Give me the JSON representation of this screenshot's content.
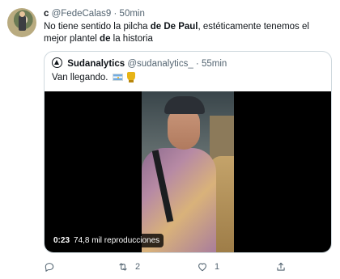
{
  "tweet": {
    "author_name": "c",
    "author_handle": "@FedeCalas9",
    "separator": "·",
    "time": "50min",
    "text_part1": "No tiene sentido la pilcha ",
    "text_bold1": "de De Paul",
    "text_part2": ", estéticamente tenemos el mejor plantel ",
    "text_bold2": "de",
    "text_part3": " la historia"
  },
  "quote": {
    "author_name": "Sudanalytics",
    "author_handle": "@sudanalytics_",
    "separator": "·",
    "time": "55min",
    "text": "Van llegando.",
    "emojis": [
      "argentina-flag",
      "trophy"
    ],
    "video": {
      "duration": "0:23",
      "views": "74,8 mil reproducciones"
    }
  },
  "actions": {
    "reply_count": "",
    "retweet_count": "2",
    "like_count": "1",
    "share_label": ""
  },
  "icons": [
    "reply-icon",
    "retweet-icon",
    "like-icon",
    "share-icon"
  ],
  "colors": {
    "text": "#0f1419",
    "muted": "#536471",
    "border": "#cfd9de"
  }
}
